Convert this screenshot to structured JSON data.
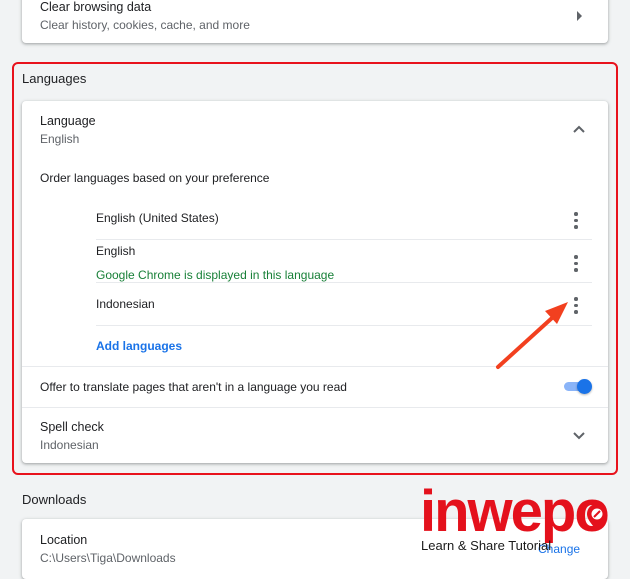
{
  "privacy": {
    "clear_title": "Clear browsing data",
    "clear_sub": "Clear history, cookies, cache, and more"
  },
  "languages": {
    "section_title": "Languages",
    "language_title": "Language",
    "language_value": "English",
    "order_text": "Order languages based on your preference",
    "list": [
      {
        "name": "English (United States)",
        "note": ""
      },
      {
        "name": "English",
        "note": "Google Chrome is displayed in this language"
      },
      {
        "name": "Indonesian",
        "note": ""
      }
    ],
    "add_label": "Add languages",
    "translate_text": "Offer to translate pages that aren't in a language you read",
    "translate_enabled": true,
    "spell_title": "Spell check",
    "spell_value": "Indonesian"
  },
  "downloads": {
    "section_title": "Downloads",
    "location_title": "Location",
    "location_value": "C:\\Users\\Tiga\\Downloads",
    "change_label": "Change"
  },
  "watermark": {
    "brand": "inwepo",
    "tagline": "Learn & Share Tutorial"
  },
  "colors": {
    "accent": "#1a73e8",
    "success": "#188038",
    "highlight": "#e8121c",
    "arrow": "#f2401f"
  },
  "icons": [
    "chevron-right-icon",
    "chevron-up-icon",
    "more-vert-icon",
    "chevron-down-icon",
    "arrow-annotation-icon",
    "location-pin-icon"
  ]
}
